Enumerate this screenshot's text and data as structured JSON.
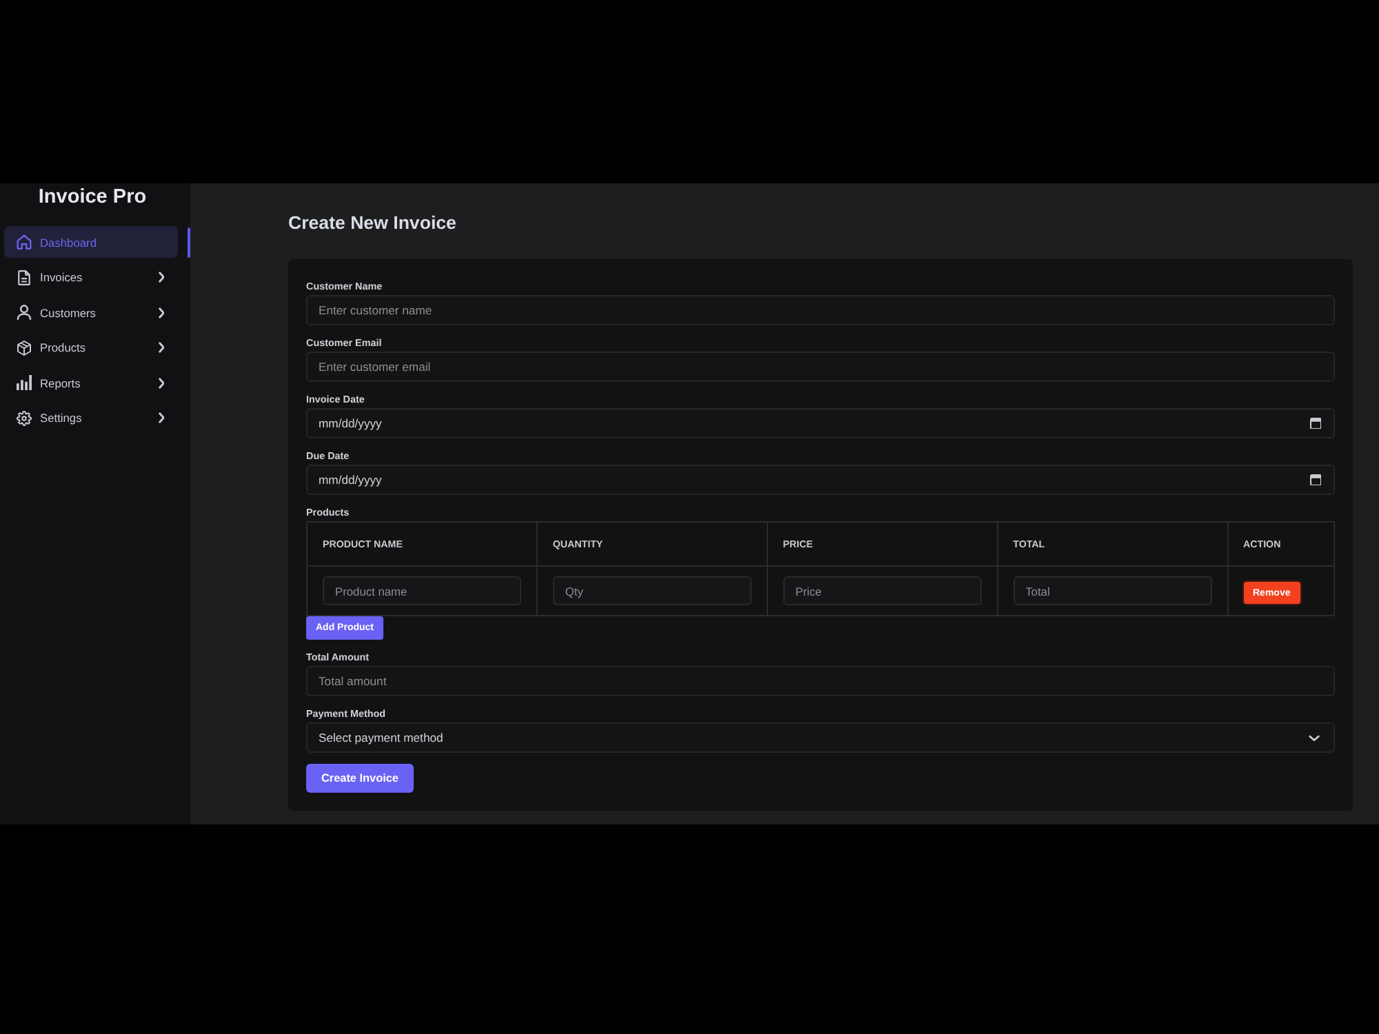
{
  "sidebar": {
    "title": "Invoice Pro",
    "items": [
      {
        "label": "Dashboard",
        "selected": true,
        "submenu": false
      },
      {
        "label": "Invoices",
        "selected": false,
        "submenu": true
      },
      {
        "label": "Customers",
        "selected": false,
        "submenu": true
      },
      {
        "label": "Products",
        "selected": false,
        "submenu": true
      },
      {
        "label": "Reports",
        "selected": false,
        "submenu": true
      },
      {
        "label": "Settings",
        "selected": false,
        "submenu": true
      }
    ]
  },
  "main": {
    "title": "Create New Invoice"
  },
  "form": {
    "fields": [
      {
        "kind": "text",
        "label": "Customer Name",
        "placeholder": "Enter customer name"
      },
      {
        "kind": "text",
        "label": "Customer Email",
        "placeholder": "Enter customer email"
      },
      {
        "kind": "date",
        "label": "Invoice Date",
        "placeholder": "mm/dd/yyyy"
      },
      {
        "kind": "date",
        "label": "Due Date",
        "placeholder": "mm/dd/yyyy"
      },
      {
        "kind": "table",
        "label": "Products",
        "columns": [
          "PRODUCT NAME",
          "QUANTITY",
          "PRICE",
          "TOTAL",
          "ACTION"
        ],
        "rows": [
          {
            "cells": [
              {
                "placeholder": "Product name"
              },
              {
                "placeholder": "Qty"
              },
              {
                "placeholder": "Price"
              },
              {
                "placeholder": "Total"
              }
            ],
            "action": "Remove"
          }
        ],
        "add_button": "Add Product"
      },
      {
        "kind": "text",
        "label": "Total Amount",
        "placeholder": "Total amount"
      },
      {
        "kind": "select",
        "label": "Payment Method",
        "value": "Select payment method"
      }
    ],
    "submit_button": "Create Invoice"
  }
}
